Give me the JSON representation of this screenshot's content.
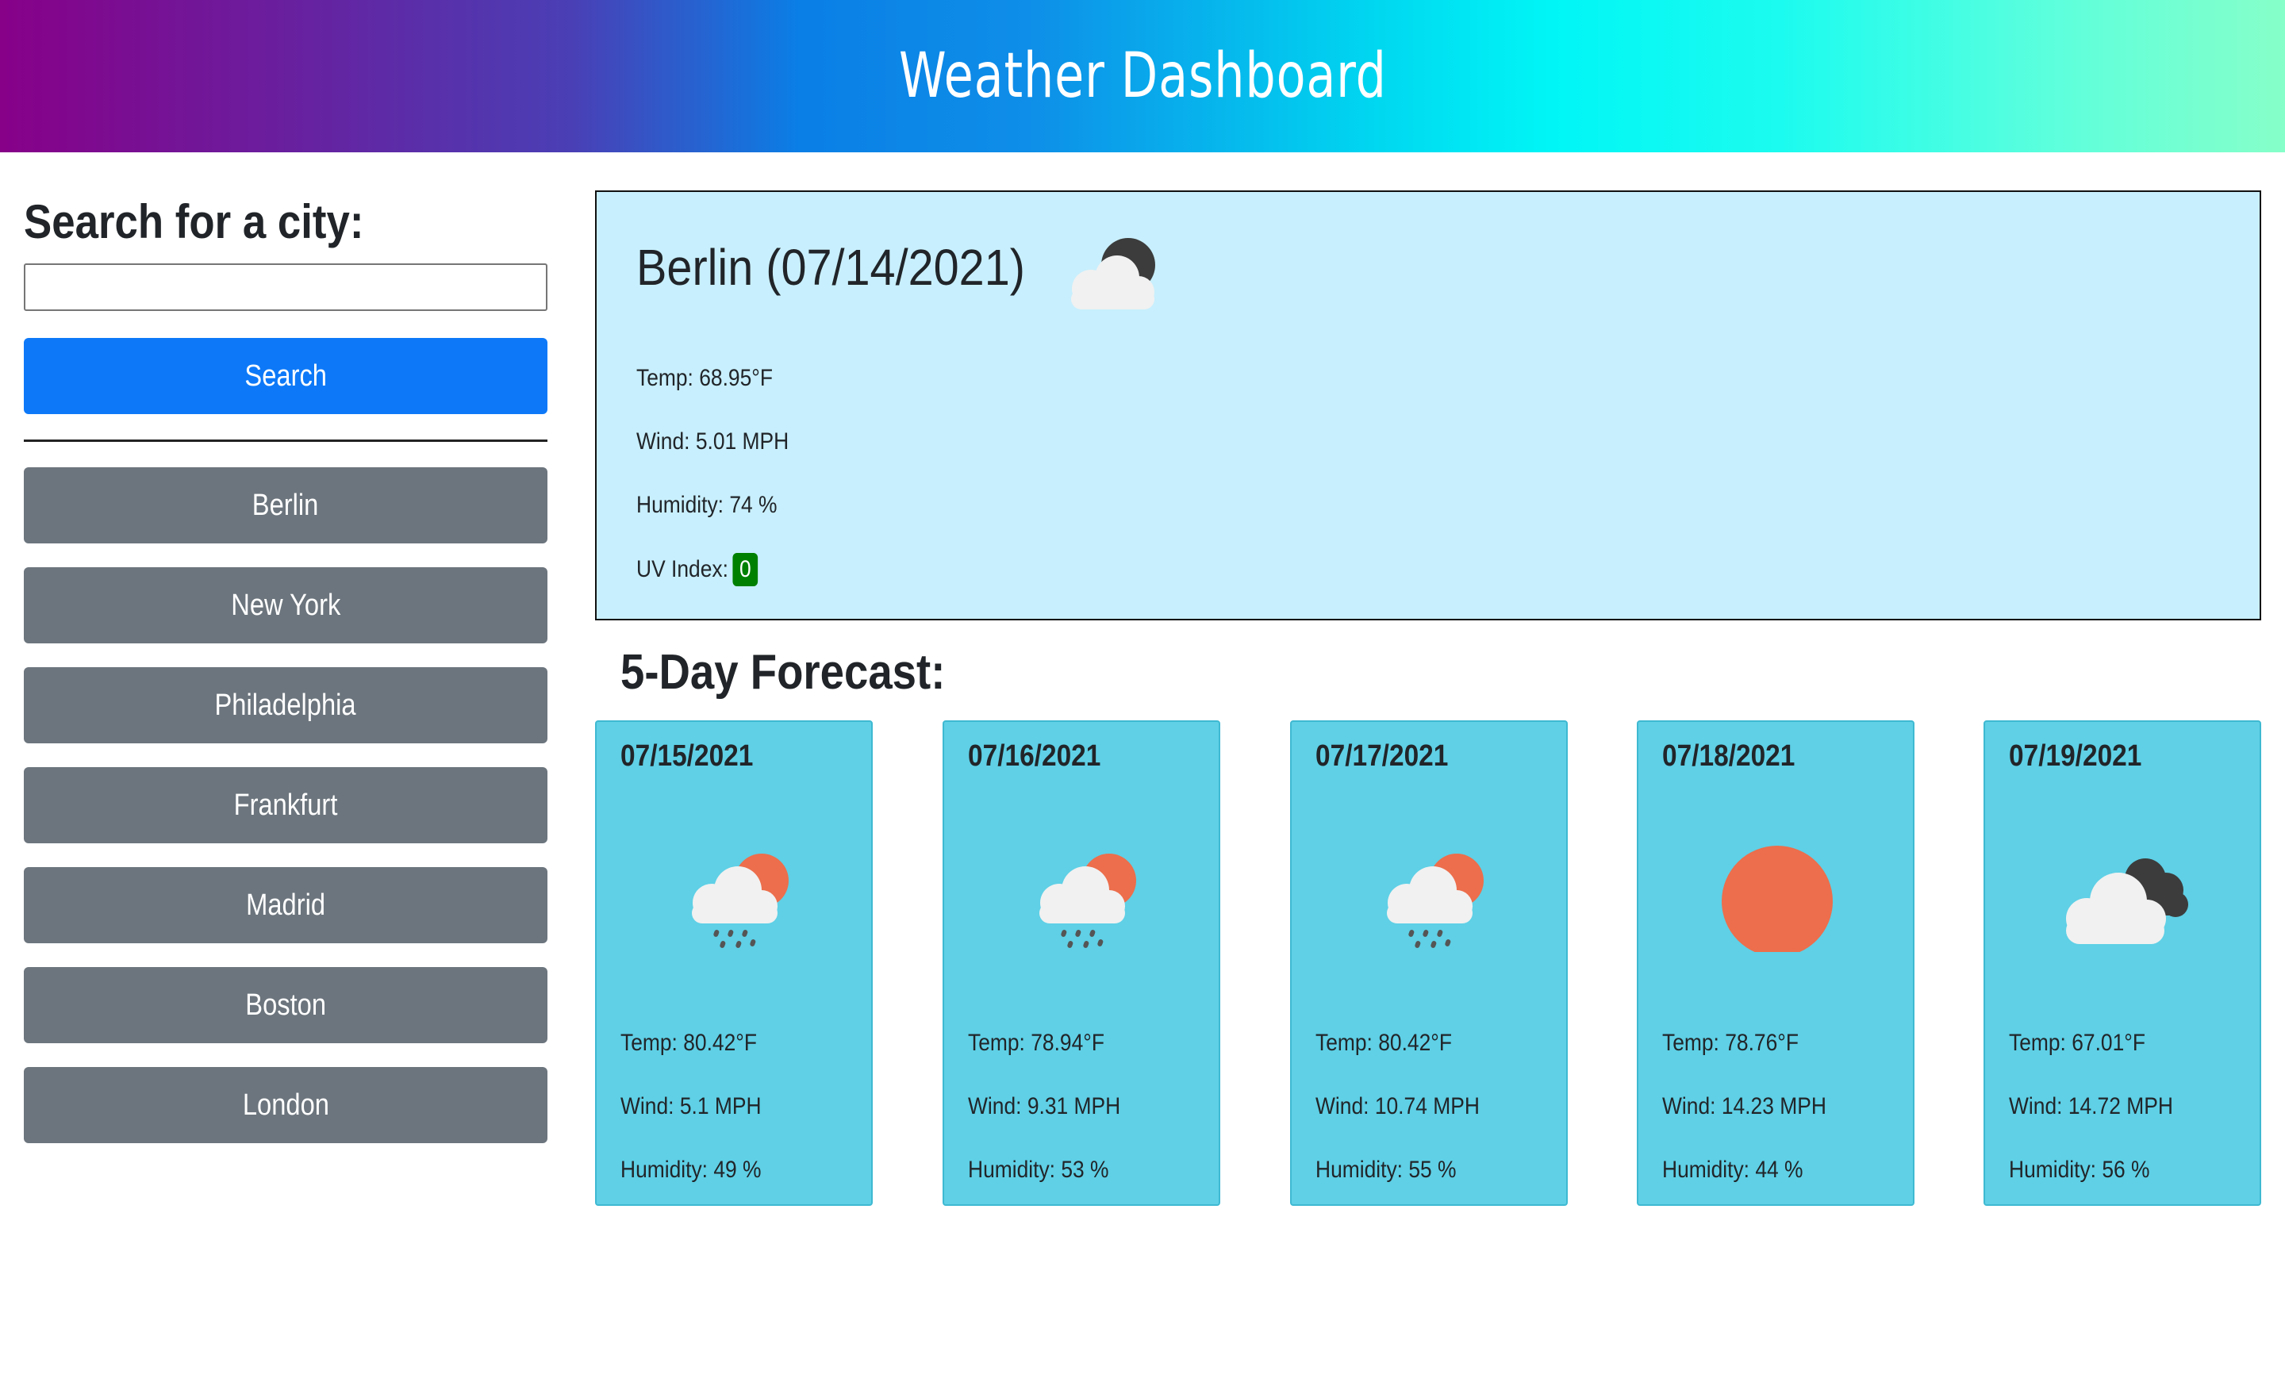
{
  "header": {
    "title": "Weather Dashboard"
  },
  "sidebar": {
    "search_label": "Search for a city:",
    "search_placeholder": "",
    "search_button": "Search",
    "history": [
      "Berlin",
      "New York",
      "Philadelphia",
      "Frankfurt",
      "Madrid",
      "Boston",
      "London"
    ]
  },
  "current": {
    "title": "Berlin (07/14/2021)",
    "icon": "partly-cloudy-night-icon",
    "temp": "Temp: 68.95°F",
    "wind": "Wind: 5.01 MPH",
    "humidity": "Humidity: 74 %",
    "uv_label": "UV Index:",
    "uv_value": "0",
    "uv_color": "#008000"
  },
  "forecast": {
    "title": "5-Day Forecast:",
    "days": [
      {
        "date": "07/15/2021",
        "icon": "rain-sun-icon",
        "temp": "Temp: 80.42°F",
        "wind": "Wind: 5.1 MPH",
        "humidity": "Humidity: 49 %"
      },
      {
        "date": "07/16/2021",
        "icon": "rain-sun-icon",
        "temp": "Temp: 78.94°F",
        "wind": "Wind: 9.31 MPH",
        "humidity": "Humidity: 53 %"
      },
      {
        "date": "07/17/2021",
        "icon": "rain-sun-icon",
        "temp": "Temp: 80.42°F",
        "wind": "Wind: 10.74 MPH",
        "humidity": "Humidity: 55 %"
      },
      {
        "date": "07/18/2021",
        "icon": "sun-icon",
        "temp": "Temp: 78.76°F",
        "wind": "Wind: 14.23 MPH",
        "humidity": "Humidity: 44 %"
      },
      {
        "date": "07/19/2021",
        "icon": "overcast-clouds-icon",
        "temp": "Temp: 67.01°F",
        "wind": "Wind: 14.72 MPH",
        "humidity": "Humidity: 56 %"
      }
    ]
  },
  "colors": {
    "search_button": "#0d79f8",
    "history_button": "#6c757d",
    "current_bg": "#c8effd",
    "card_bg": "#5fd0e6",
    "sun": "#ec6e4c"
  }
}
